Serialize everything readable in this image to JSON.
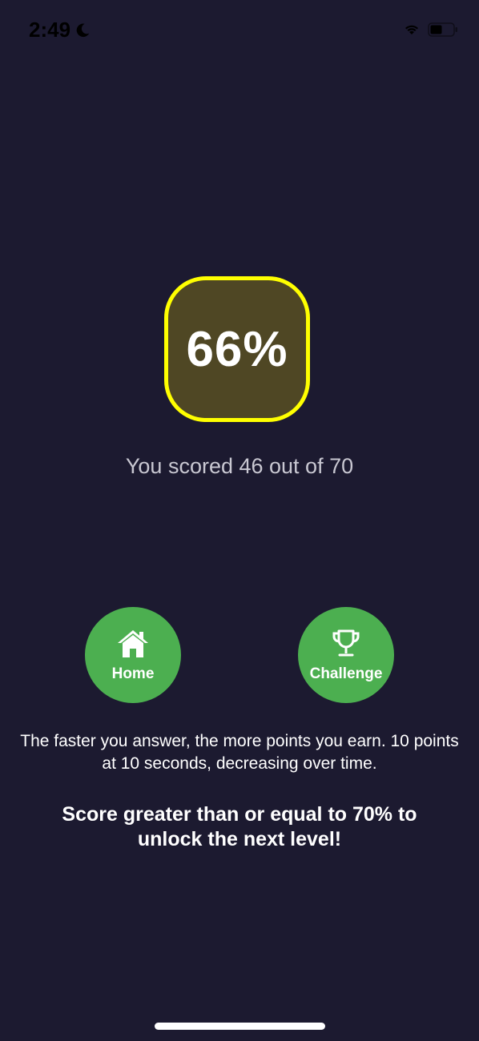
{
  "status_bar": {
    "time": "2:49",
    "moon_icon": "moon-icon",
    "wifi_icon": "wifi-icon",
    "battery_icon": "battery-icon"
  },
  "score": {
    "percent": "66%",
    "summary": "You scored 46 out of 70",
    "badge_border_color": "#ffff00"
  },
  "actions": {
    "home": {
      "label": "Home",
      "icon": "home-icon"
    },
    "challenge": {
      "label": "Challenge",
      "icon": "trophy-icon"
    },
    "button_color": "#4caf50"
  },
  "info": {
    "speed_text": "The faster you answer, the more points you earn. 10 points at 10 seconds, decreasing over time.",
    "unlock_text": "Score greater than or equal to 70% to unlock the next level!"
  }
}
